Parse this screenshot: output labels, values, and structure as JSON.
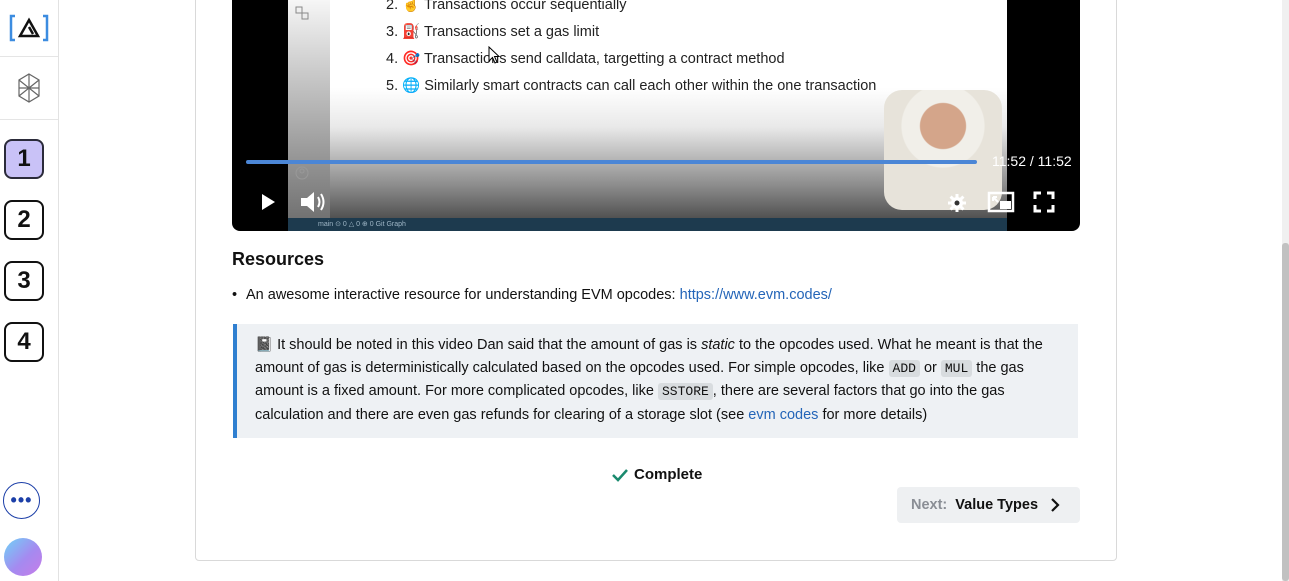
{
  "sidebar": {
    "steps": [
      "1",
      "2",
      "3",
      "4"
    ],
    "more_label": "•••"
  },
  "video": {
    "slide_items": [
      {
        "num": "2.",
        "emoji": "☝",
        "text": "Transactions occur sequentially"
      },
      {
        "num": "3.",
        "emoji": "⛽",
        "text": "Transactions set a gas limit"
      },
      {
        "num": "4.",
        "emoji": "🎯",
        "text": "Transactions send calldata, targetting a contract method"
      },
      {
        "num": "5.",
        "emoji": "🌐",
        "text": "Similarly smart contracts can call each other within the one transaction"
      }
    ],
    "status_text": "main  ⊙ 0 △ 0   ⊕ 0   Git Graph",
    "time": "11:52 / 11:52",
    "progress": 1.0
  },
  "resources": {
    "title": "Resources",
    "item_text": "An awesome interactive resource for understanding EVM opcodes: ",
    "item_link": "https://www.evm.codes/"
  },
  "note": {
    "emoji": "📓",
    "part1": " It should be noted in this video Dan said that the amount of gas is ",
    "static_word": "static",
    "part2": " to the opcodes used. What he meant is that the amount of gas is deterministically calculated based on the opcodes used. For simple opcodes, like ",
    "code1": "ADD",
    "or_word": " or ",
    "code2": "MUL",
    "part3": " the gas amount is a fixed amount. For more complicated opcodes, like ",
    "code3": "SSTORE",
    "part4": ", there are several factors that go into the gas calculation and there are even gas refunds for clearing of a storage slot (see ",
    "link": "evm codes",
    "part5": " for more details)"
  },
  "complete_label": "Complete",
  "next": {
    "prefix": "Next:",
    "label": "Value Types"
  },
  "colors": {
    "accent": "#2465b8",
    "progress": "#4b86d6",
    "active_step": "#c9c2f7",
    "check": "#1a8a6e"
  }
}
